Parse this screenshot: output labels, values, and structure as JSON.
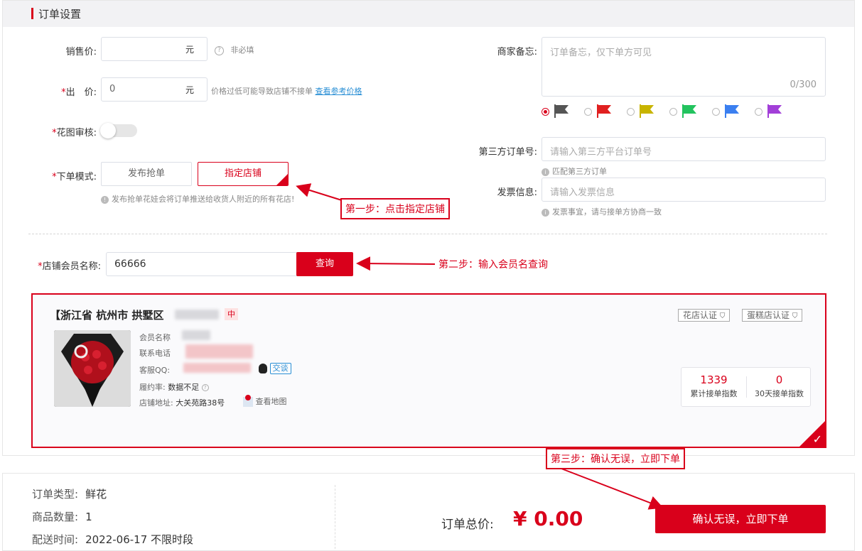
{
  "section": {
    "title": "订单设置"
  },
  "form": {
    "sale_price": {
      "label": "销售价:",
      "unit": "元",
      "hint": "非必填"
    },
    "out_price": {
      "required": "*",
      "label": "出　价:",
      "value": "0",
      "unit": "元",
      "hint": "价格过低可能导致店铺不接单",
      "link": "查看参考价格"
    },
    "flower_review": {
      "required": "*",
      "label": "花图审核:",
      "enabled": false
    },
    "order_mode": {
      "required": "*",
      "label": "下单模式:",
      "options": [
        "发布抢单",
        "指定店铺"
      ],
      "selected": "指定店铺",
      "hint": "发布抢单花娃会将订单推送给收货人附近的所有花店!"
    },
    "merchant_note": {
      "label": "商家备忘:",
      "placeholder": "订单备忘，仅下单方可见",
      "count": "0/300"
    },
    "flag_colors": [
      "#555555",
      "#e02020",
      "#c8b400",
      "#22c35e",
      "#3b7ff0",
      "#a23fd8"
    ],
    "third_party": {
      "label": "第三方订单号:",
      "placeholder": "请输入第三方平台订单号",
      "hint": "匹配第三方订单"
    },
    "invoice": {
      "label": "发票信息:",
      "placeholder": "请输入发票信息",
      "hint": "发票事宜，请与接单方协商一致"
    },
    "shop_member": {
      "required": "*",
      "label": "店铺会员名称:",
      "value": "66666",
      "button": "查询"
    }
  },
  "annotations": {
    "step1": "第一步：点击指定店铺",
    "step2": "第二步：输入会员名查询",
    "step3": "第三步：确认无误，立即下单"
  },
  "shop": {
    "title": "【浙江省 杭州市 拱墅区",
    "status": "中",
    "badges": [
      "花店认证",
      "蛋糕店认证"
    ],
    "member_label": "会员名称",
    "phone_label": "联系电话",
    "qq_label": "客服QQ:",
    "talk": "交谈",
    "fulfill_label": "履约率:",
    "fulfill_value": "数据不足",
    "address_label": "店铺地址:",
    "address_value": "大关苑路38号",
    "map_link": "查看地图",
    "stats": [
      {
        "value": "1339",
        "label": "累计接单指数"
      },
      {
        "value": "0",
        "label": "30天接单指数"
      }
    ]
  },
  "summary": {
    "order_type_label": "订单类型:",
    "order_type": "鲜花",
    "qty_label": "商品数量:",
    "qty": "1",
    "delivery_label": "配送时间:",
    "delivery": "2022-06-17 不限时段",
    "total_label": "订单总价:",
    "total": "¥ 0.00",
    "confirm_button": "确认无误，立即下单"
  }
}
